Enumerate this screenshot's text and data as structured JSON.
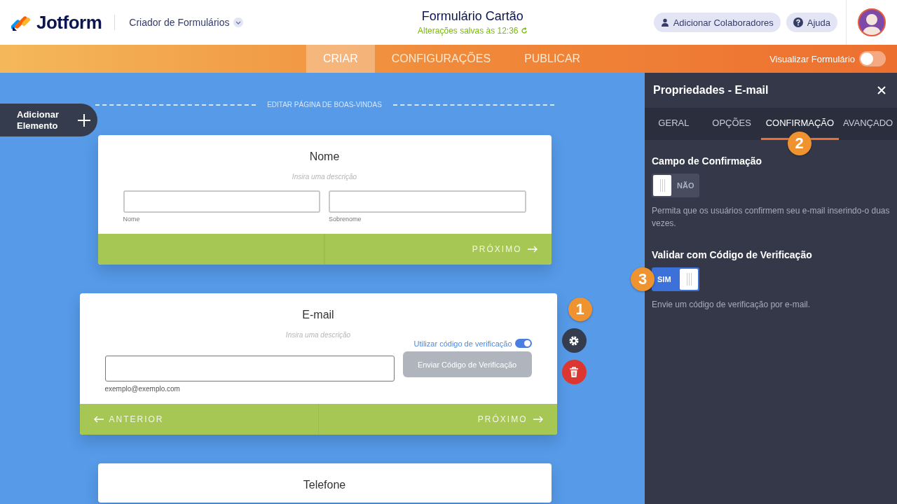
{
  "header": {
    "logo": "Jotform",
    "builder_menu": "Criador de Formulários",
    "title": "Formulário Cartão",
    "saved_status": "Alterações salvas às 12:36",
    "buttons": [
      {
        "kind": "collaborators",
        "label": "Adicionar Colaboradores"
      },
      {
        "kind": "help",
        "label": "Ajuda"
      }
    ]
  },
  "nav": {
    "tabs": [
      {
        "label": "CRIAR",
        "selected": true
      },
      {
        "label": "CONFIGURAÇÕES",
        "selected": false
      },
      {
        "label": "PUBLICAR",
        "selected": false
      }
    ],
    "preview": {
      "label": "Visualizar Formulário",
      "on": false
    }
  },
  "canvas": {
    "add_element": "Adicionar Elemento",
    "welcome_link": "EDITAR PÁGINA DE BOAS-VINDAS",
    "cards": [
      {
        "kind": "name",
        "title": "Nome",
        "description": "Insira uma descrição",
        "selected": false,
        "sublabels": [
          "Nome",
          "Sobrenome"
        ],
        "next": "PRÓXIMO"
      },
      {
        "kind": "email",
        "title": "E-mail",
        "description": "Insira uma descrição",
        "selected": true,
        "verify_label": "Utilizar código de verificação",
        "verify_on": true,
        "send_button": "Enviar Código de Verificação",
        "sublabel": "exemplo@exemplo.com",
        "previous": "ANTERIOR",
        "next": "PRÓXIMO",
        "callout": "1"
      },
      {
        "kind": "phone",
        "title": "Telefone",
        "selected": false
      }
    ]
  },
  "panel": {
    "title": "Propriedades - E-mail",
    "tabs": [
      {
        "label": "GERAL",
        "selected": false
      },
      {
        "label": "OPÇÕES",
        "selected": false
      },
      {
        "label": "CONFIRMAÇÃO",
        "selected": true,
        "callout": "2"
      },
      {
        "label": "AVANÇADO",
        "selected": false
      }
    ],
    "settings": [
      {
        "title": "Campo de Confirmação",
        "on": false,
        "state_label": "NÃO",
        "description": "Permita que os usuários confirmem seu e-mail inserindo-o duas vezes."
      },
      {
        "title": "Validar com Código de Verificação",
        "on": true,
        "state_label": "SIM",
        "description": "Envie um código de verificação por e-mail.",
        "callout": "3"
      }
    ]
  }
}
